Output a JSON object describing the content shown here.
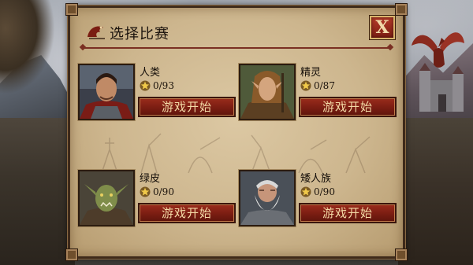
{
  "dialog": {
    "title": "选择比赛",
    "close_label": "X"
  },
  "races": [
    {
      "name": "人类",
      "progress": "0/93",
      "button_label": "游戏开始"
    },
    {
      "name": "精灵",
      "progress": "0/87",
      "button_label": "游戏开始"
    },
    {
      "name": "绿皮",
      "progress": "0/90",
      "button_label": "游戏开始"
    },
    {
      "name": "矮人族",
      "progress": "0/90",
      "button_label": "游戏开始"
    }
  ],
  "icons": {
    "title": "dragon-emblem-icon",
    "progress": "star-icon",
    "close": "close-icon"
  },
  "colors": {
    "parchment": "#cdb68e",
    "button_red": "#7a1d12",
    "button_text": "#f3d9a6",
    "frame": "#3e2a1a"
  }
}
